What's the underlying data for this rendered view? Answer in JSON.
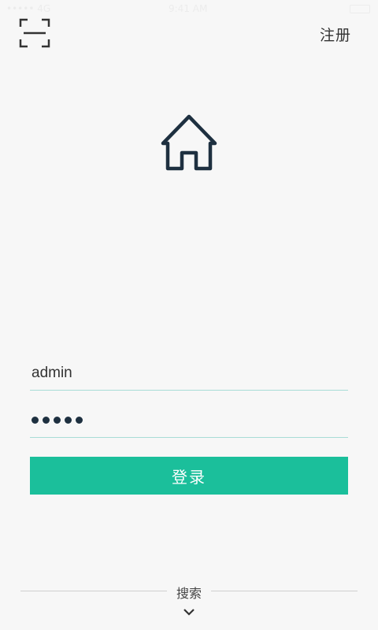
{
  "status_bar": {
    "carrier": "••••• 4G",
    "time": "9:41 AM"
  },
  "header": {
    "scan_icon": "scan-frame-icon",
    "register_label": "注册"
  },
  "logo": {
    "icon": "house-icon",
    "color": "#1e3040"
  },
  "login_form": {
    "username_value": "admin",
    "password_masked_length": 5,
    "login_label": "登录",
    "accent_color": "#1bbf9b"
  },
  "footer": {
    "search_label": "搜索",
    "expand_icon": "chevron-down-icon"
  }
}
